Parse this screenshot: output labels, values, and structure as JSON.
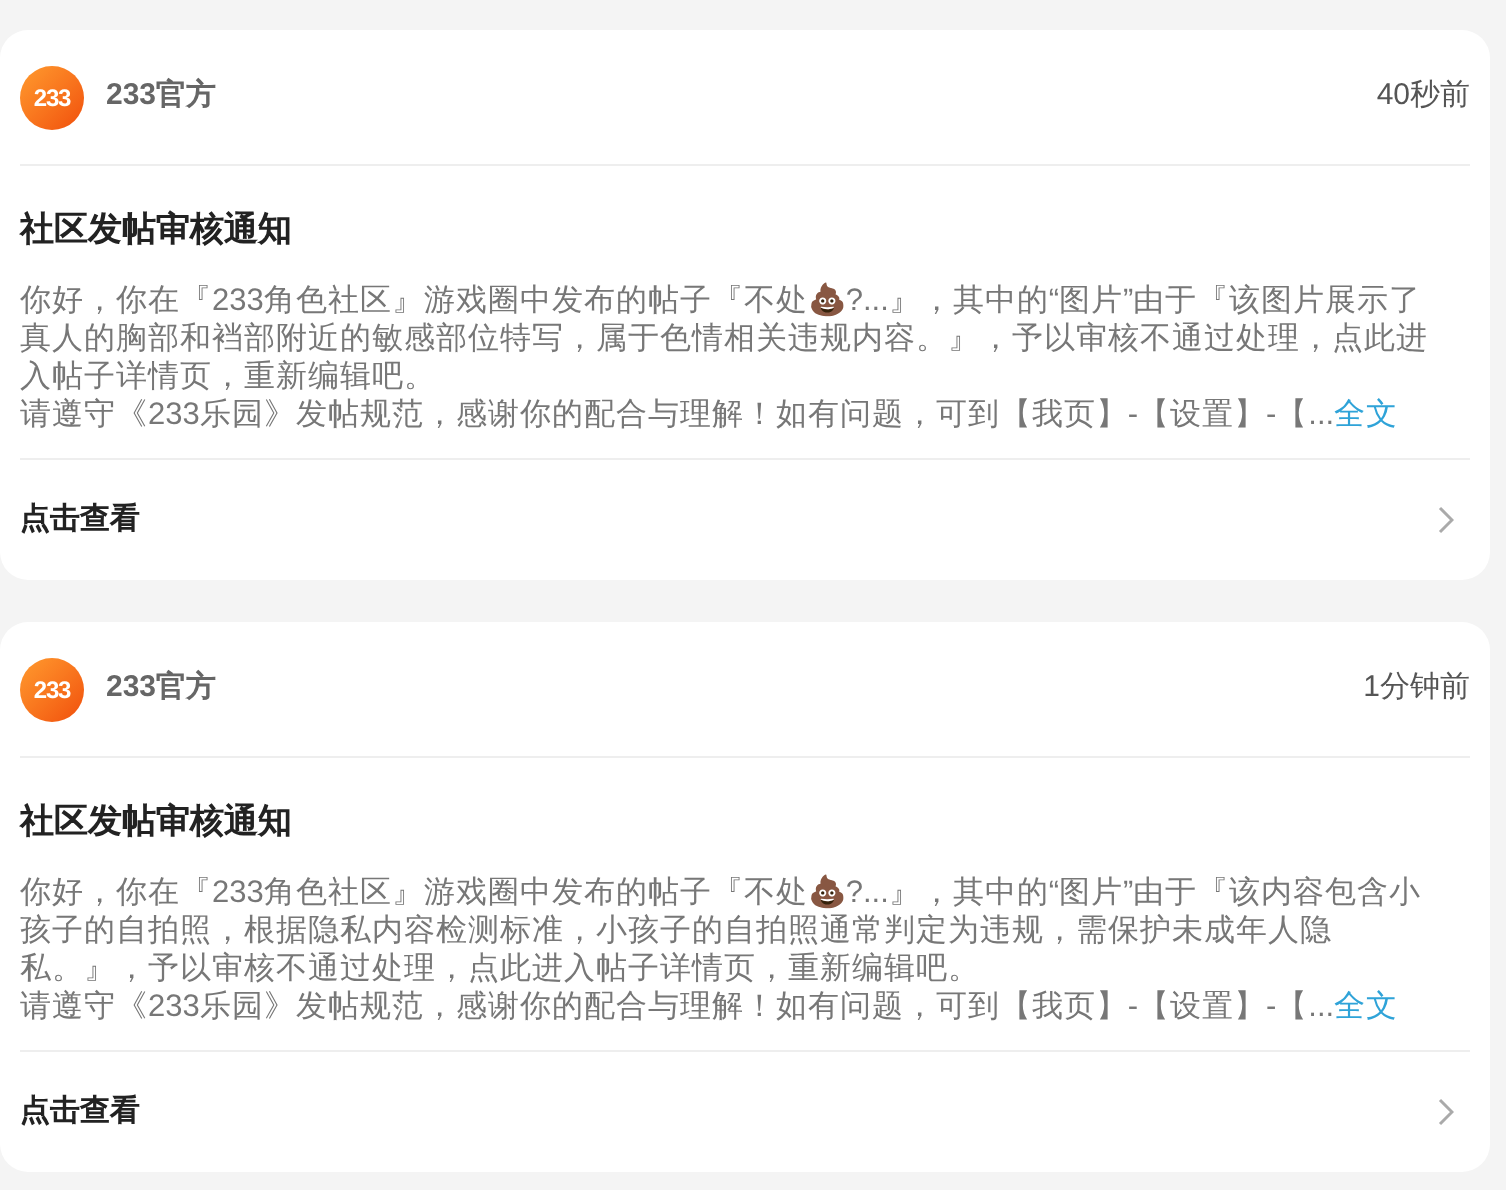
{
  "notifications": [
    {
      "logo_text": "233",
      "sender": "233官方",
      "time": "40秒前",
      "title": "社区发帖审核通知",
      "body": "你好，你在『233角色社区』游戏圈中发布的帖子『不处💩?...』，其中的“图片”由于『该图片展示了真人的胸部和裆部附近的敏感部位特写，属于色情相关违规内容。』，予以审核不通过处理，点此进入帖子详情页，重新编辑吧。",
      "notice": "请遵守《233乐园》发帖规范，感谢你的配合与理解！如有问题，可到【我页】-【设置】-【...",
      "more_link": "全文",
      "action": "点击查看"
    },
    {
      "logo_text": "233",
      "sender": "233官方",
      "time": "1分钟前",
      "title": "社区发帖审核通知",
      "body": "你好，你在『233角色社区』游戏圈中发布的帖子『不处💩?...』，其中的“图片”由于『该内容包含小孩子的自拍照，根据隐私内容检测标准，小孩子的自拍照通常判定为违规，需保护未成年人隐私。』，予以审核不通过处理，点此进入帖子详情页，重新编辑吧。",
      "notice": "请遵守《233乐园》发帖规范，感谢你的配合与理解！如有问题，可到【我页】-【设置】-【...",
      "more_link": "全文",
      "action": "点击查看"
    }
  ]
}
